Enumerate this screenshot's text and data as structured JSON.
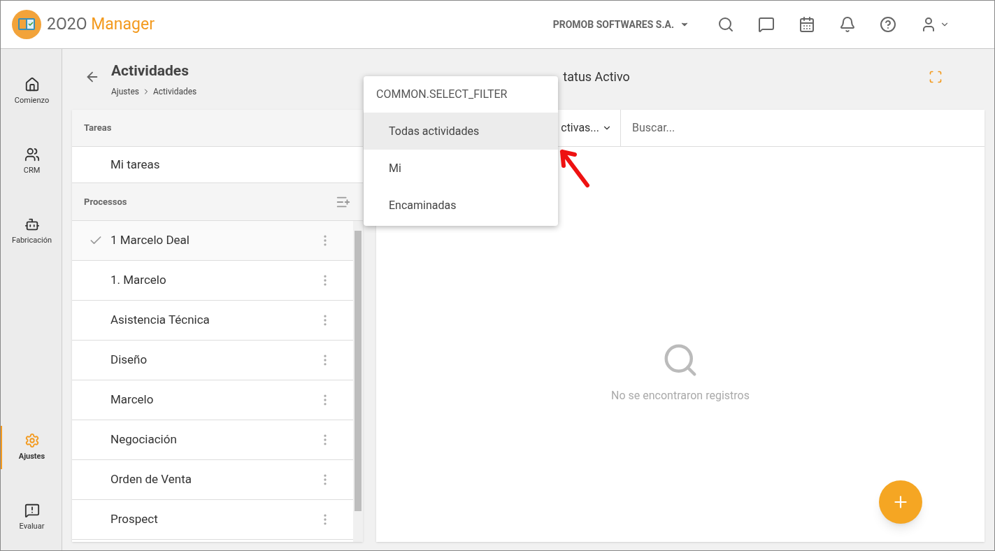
{
  "header": {
    "logo_number": "2O2O",
    "logo_word": "Manager",
    "company": "PROMOB SOFTWARES S.A."
  },
  "nav": [
    {
      "label": "Comienzo",
      "selected": false
    },
    {
      "label": "CRM",
      "selected": false
    },
    {
      "label": "Fabricación",
      "selected": false
    },
    {
      "label": "Ajustes",
      "selected": true
    },
    {
      "label": "Evaluar",
      "selected": false
    }
  ],
  "page": {
    "title": "Actividades",
    "breadcrumb": [
      "Ajustes",
      "Actividades"
    ],
    "subtitle": "tatus Activo"
  },
  "tasks": {
    "heading": "Tareas",
    "items": [
      "Mi tareas"
    ]
  },
  "processes": {
    "heading": "Processos",
    "items": [
      {
        "label": "1 Marcelo Deal",
        "selected": true
      },
      {
        "label": "1. Marcelo",
        "selected": false
      },
      {
        "label": "Asistencia Técnica",
        "selected": false
      },
      {
        "label": "Diseño",
        "selected": false
      },
      {
        "label": "Marcelo",
        "selected": false
      },
      {
        "label": "Negociación",
        "selected": false
      },
      {
        "label": "Orden de Venta",
        "selected": false
      },
      {
        "label": "Prospect",
        "selected": false
      }
    ]
  },
  "filter": {
    "value": "ctivas...",
    "search_placeholder": "Buscar..."
  },
  "empty": "No se encontraron registros",
  "menu": {
    "title": "COMMON.SELECT_FILTER",
    "items": [
      {
        "label": "Todas actividades",
        "selected": true
      },
      {
        "label": "Mi",
        "selected": false
      },
      {
        "label": "Encaminadas",
        "selected": false
      }
    ]
  }
}
